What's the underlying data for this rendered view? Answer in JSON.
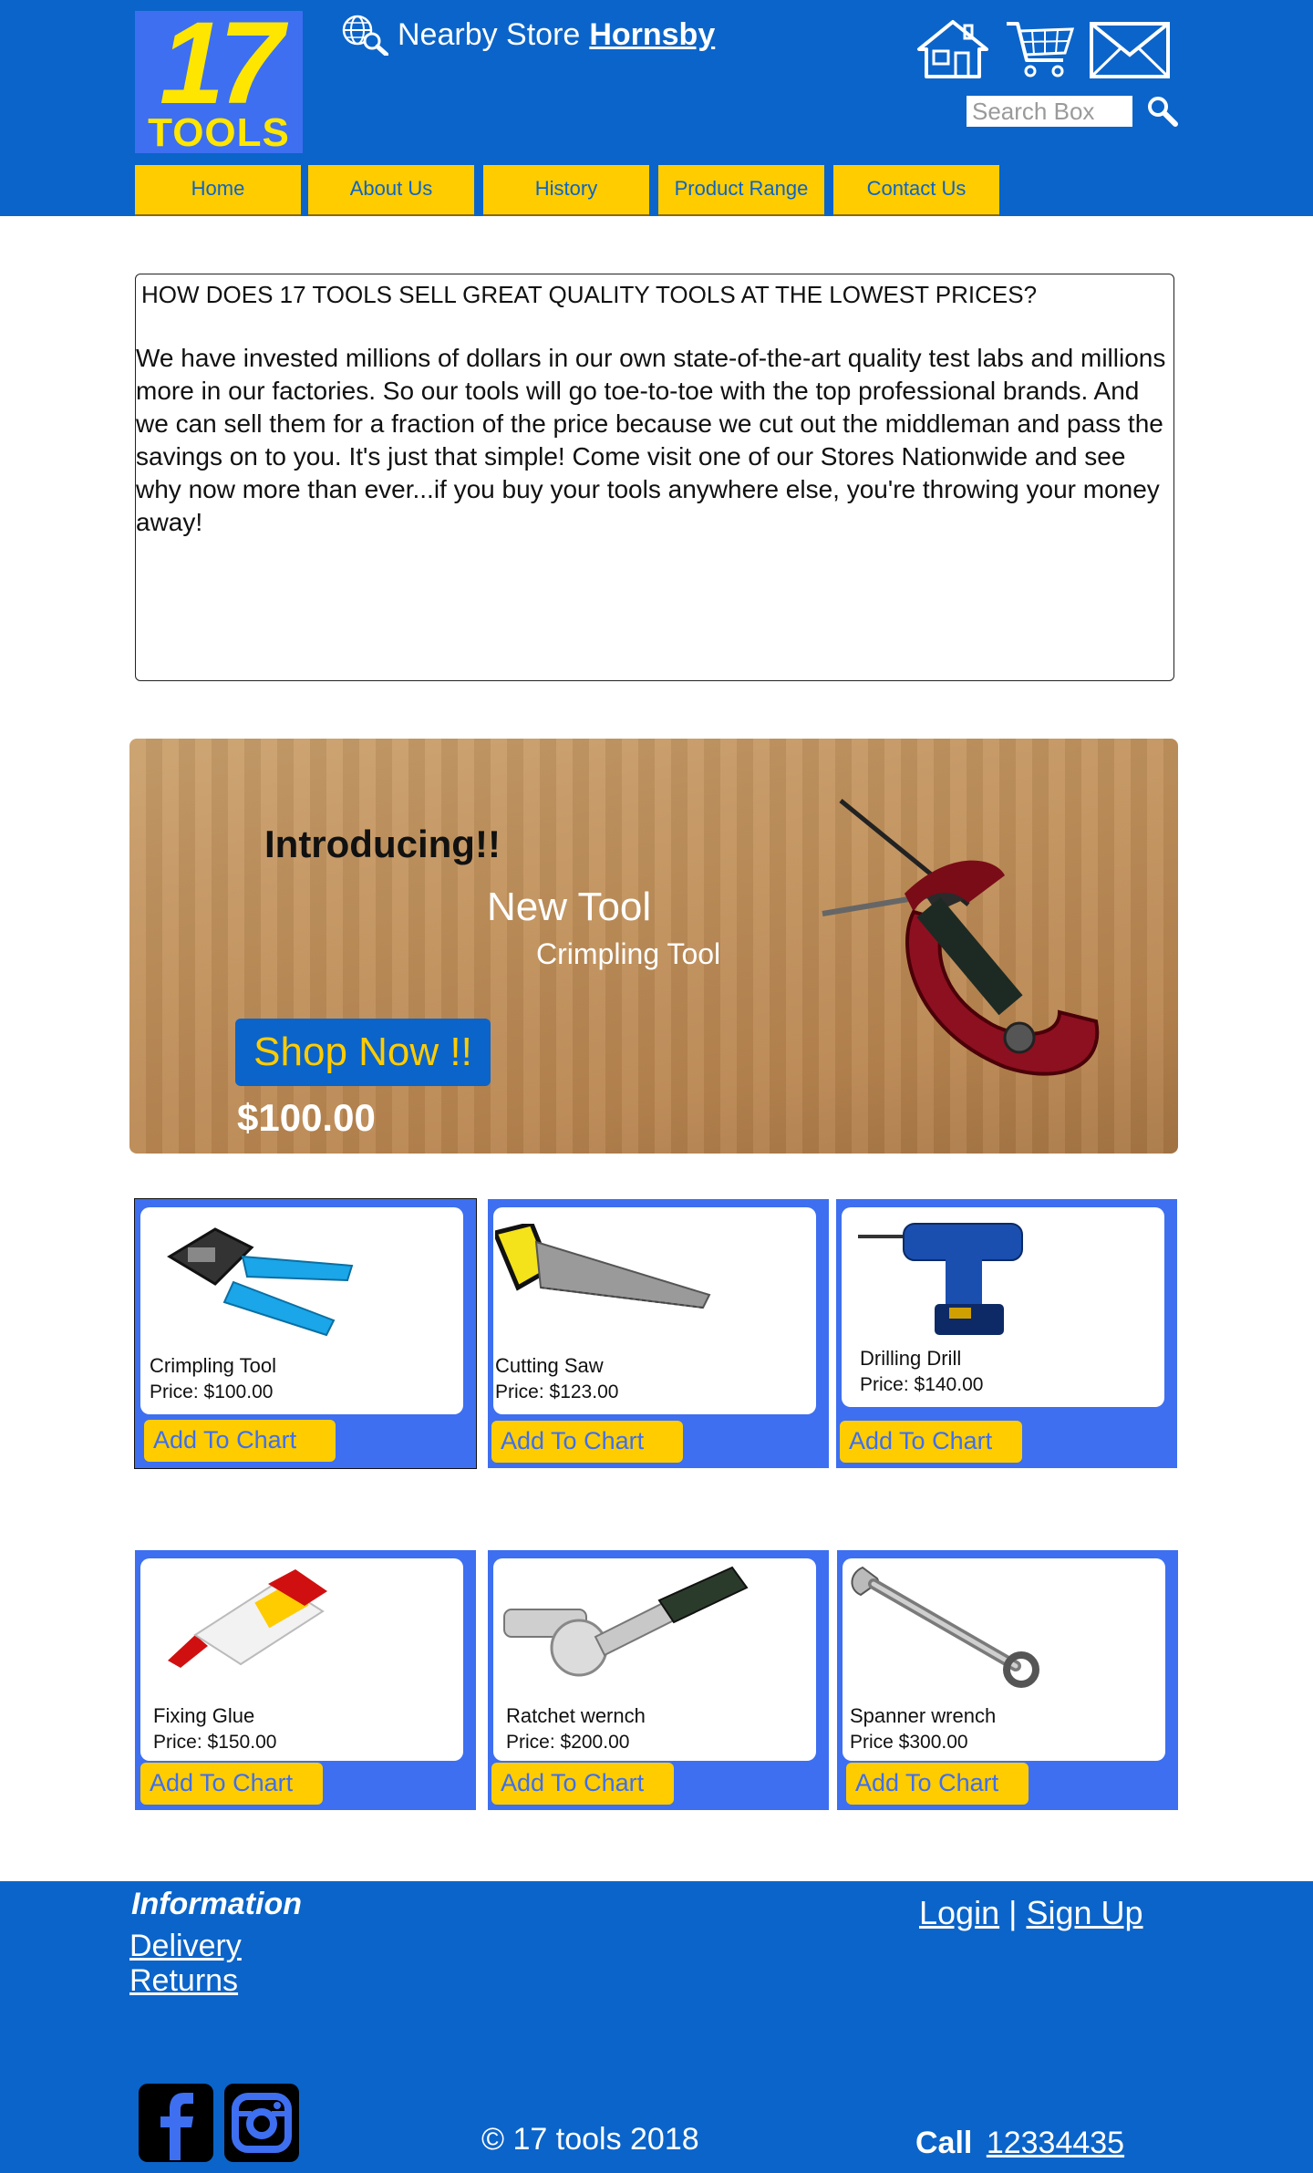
{
  "brand": {
    "logo_number": "17",
    "logo_word": "TOOLS"
  },
  "header": {
    "nearby_label": "Nearby Store",
    "nearby_store": "Hornsby",
    "search_placeholder": "Search Box"
  },
  "nav": [
    "Home",
    "About Us",
    "History",
    "Product Range",
    "Contact Us"
  ],
  "intro": {
    "question": "HOW DOES 17 TOOLS SELL GREAT QUALITY TOOLS AT THE LOWEST PRICES?",
    "body": "We have invested millions of dollars in our own state-of-the-art quality test labs and millions more in our factories. So our tools will go toe-to-toe with the top professional brands. And we can sell them for a fraction of the price because we cut out the middleman and pass the savings on to you. It's just that simple! Come visit one of our Stores Nationwide and see why now more than ever...if you buy your tools anywhere else, you're throwing your money away!"
  },
  "hero": {
    "heading": "Introducing!!",
    "subheading": "New Tool",
    "product": "Crimpling Tool",
    "cta": "Shop Now !!",
    "price": "$100.00"
  },
  "products": [
    {
      "name": "Crimpling Tool",
      "price": "Price: $100.00",
      "button": "Add To Chart",
      "icon": "crimping-tool-image"
    },
    {
      "name": "Cutting Saw",
      "price": "Price: $123.00",
      "button": "Add To Chart",
      "icon": "hand-saw-image"
    },
    {
      "name": "Drilling Drill",
      "price": "Price: $140.00",
      "button": "Add To Chart",
      "icon": "cordless-drill-image"
    },
    {
      "name": "Fixing Glue",
      "price": "Price: $150.00",
      "button": "Add To Chart",
      "icon": "glue-bottle-image"
    },
    {
      "name": "Ratchet wernch",
      "price": "Price: $200.00",
      "button": "Add To Chart",
      "icon": "ratchet-wrench-image"
    },
    {
      "name": "Spanner wrench",
      "price": "Price $300.00",
      "button": "Add To Chart",
      "icon": "spanner-wrench-image"
    }
  ],
  "footer": {
    "info_title": "Information",
    "links": [
      "Delivery",
      "Returns"
    ],
    "login": "Login",
    "separator": "|",
    "signup": "Sign Up",
    "copyright": "© 17 tools 2018",
    "call_label": "Call",
    "phone": "12334435"
  },
  "colors": {
    "brand_blue": "#0b64c9",
    "card_blue": "#3d6ff0",
    "accent_yellow": "#ffcc00"
  }
}
